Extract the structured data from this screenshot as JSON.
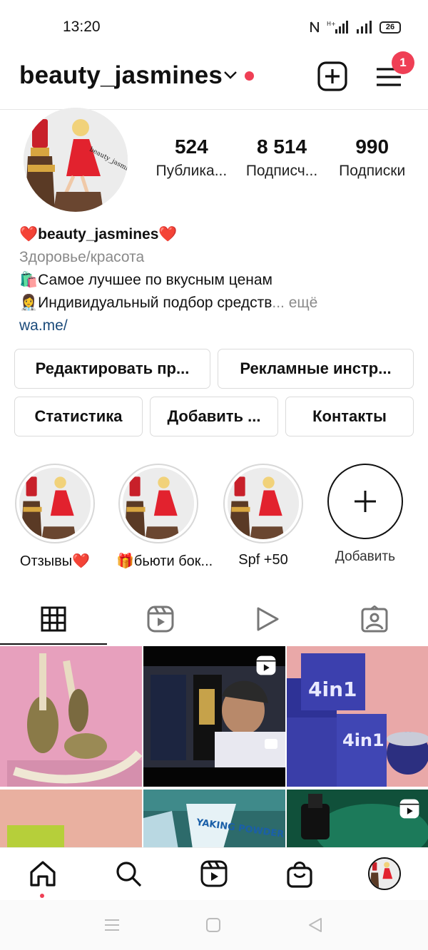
{
  "status_bar": {
    "time": "13:20",
    "battery": "26"
  },
  "header": {
    "username": "beauty_jasmines",
    "notification_count": "1"
  },
  "stats": [
    {
      "value": "524",
      "label": "Публика..."
    },
    {
      "value": "8 514",
      "label": "Подписч..."
    },
    {
      "value": "990",
      "label": "Подписки"
    }
  ],
  "bio": {
    "name": "beauty_jasmines",
    "category": "Здоровье/красота",
    "line1": "Самое лучшее по вкусным ценам",
    "line2": "Индивидуальный подбор средств",
    "more": "... ещё",
    "link": "wa.me/"
  },
  "buttons": {
    "edit": "Редактировать пр...",
    "ads": "Рекламные инстр...",
    "stats": "Статистика",
    "add": "Добавить ...",
    "contacts": "Контакты"
  },
  "highlights": [
    {
      "label": "Отзывы❤️"
    },
    {
      "label": "🎁бьюти бок..."
    },
    {
      "label": "Spf +50"
    }
  ],
  "add_highlight_label": "Добавить",
  "grid_posts": {
    "post2_text": "YAKING POWDER"
  },
  "colors": {
    "accent_red": "#ef3f55",
    "link": "#1a4a7a",
    "muted": "#8a8a8a"
  }
}
